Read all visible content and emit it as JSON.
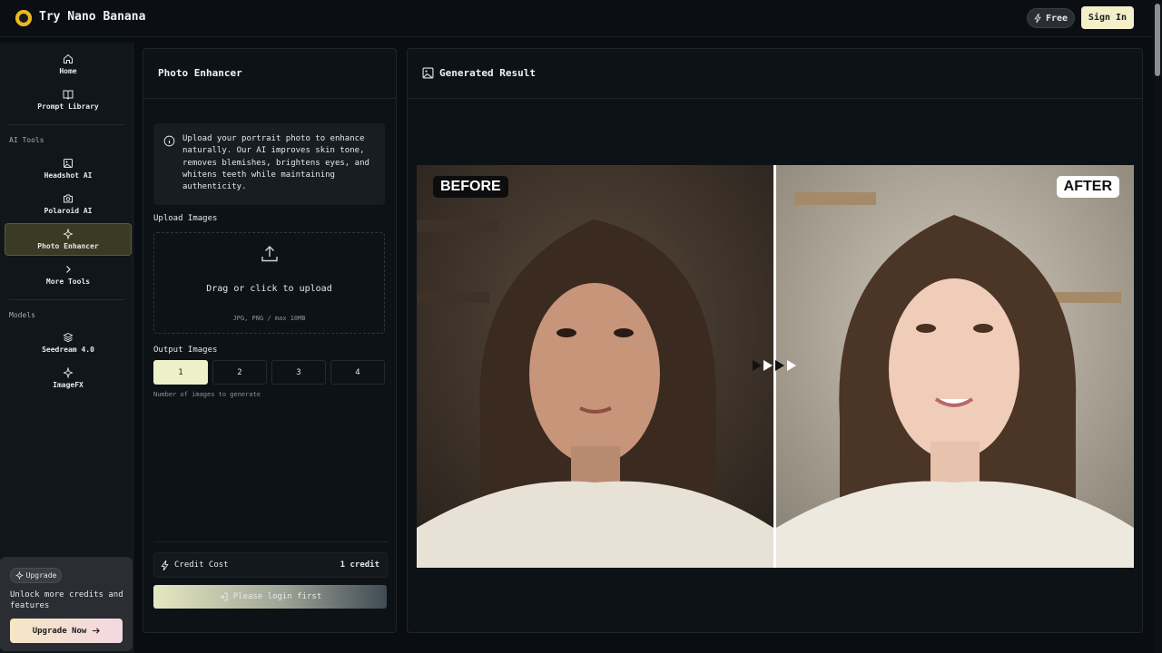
{
  "app": {
    "brand": "Try Nano Banana"
  },
  "header": {
    "free_label": "Free",
    "signin_label": "Sign In"
  },
  "sidebar": {
    "home": "Home",
    "prompt_library": "Prompt Library",
    "section_ai_tools": "AI Tools",
    "headshot": "Headshot AI",
    "polaroid": "Polaroid AI",
    "photo_enhancer": "Photo Enhancer",
    "more_tools": "More Tools",
    "section_models": "Models",
    "seedream": "Seedream 4.0",
    "imagefx": "ImageFX",
    "upgrade_badge": "Upgrade",
    "upgrade_text": "Unlock more credits and features",
    "upgrade_button": "Upgrade Now"
  },
  "panel": {
    "title": "Photo Enhancer",
    "info": "Upload your portrait photo to enhance naturally. Our AI improves skin tone, removes blemishes, brightens eyes, and whitens teeth while maintaining authenticity.",
    "upload_label": "Upload Images",
    "drop_main": "Drag or click to upload",
    "drop_sub": "JPG, PNG / max 10MB",
    "output_label": "Output Images",
    "counts": [
      "1",
      "2",
      "3",
      "4"
    ],
    "selected_count": "1",
    "hint": "Number of images to generate",
    "credit_label": "Credit Cost",
    "credit_value": "1 credit",
    "login_button": "Please login first"
  },
  "result": {
    "title": "Generated Result",
    "before_label": "BEFORE",
    "after_label": "AFTER"
  },
  "colors": {
    "accent": "#eef0c8",
    "active_nav": "#3a3b24",
    "logo": "#e8b923"
  }
}
